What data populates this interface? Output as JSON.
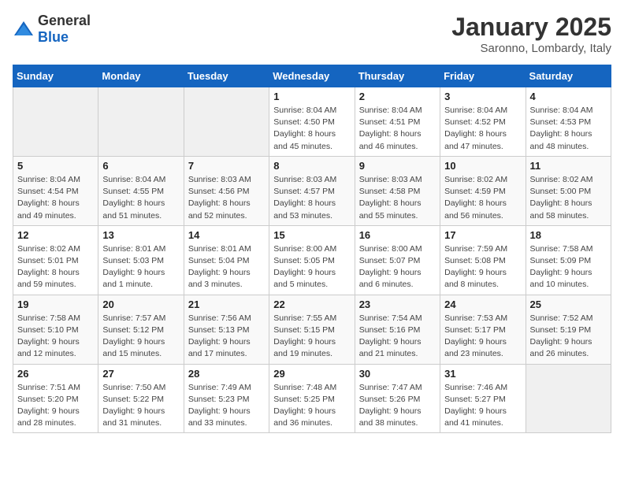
{
  "logo": {
    "general": "General",
    "blue": "Blue"
  },
  "header": {
    "month": "January 2025",
    "location": "Saronno, Lombardy, Italy"
  },
  "weekdays": [
    "Sunday",
    "Monday",
    "Tuesday",
    "Wednesday",
    "Thursday",
    "Friday",
    "Saturday"
  ],
  "weeks": [
    [
      {
        "day": "",
        "info": ""
      },
      {
        "day": "",
        "info": ""
      },
      {
        "day": "",
        "info": ""
      },
      {
        "day": "1",
        "info": "Sunrise: 8:04 AM\nSunset: 4:50 PM\nDaylight: 8 hours and 45 minutes."
      },
      {
        "day": "2",
        "info": "Sunrise: 8:04 AM\nSunset: 4:51 PM\nDaylight: 8 hours and 46 minutes."
      },
      {
        "day": "3",
        "info": "Sunrise: 8:04 AM\nSunset: 4:52 PM\nDaylight: 8 hours and 47 minutes."
      },
      {
        "day": "4",
        "info": "Sunrise: 8:04 AM\nSunset: 4:53 PM\nDaylight: 8 hours and 48 minutes."
      }
    ],
    [
      {
        "day": "5",
        "info": "Sunrise: 8:04 AM\nSunset: 4:54 PM\nDaylight: 8 hours and 49 minutes."
      },
      {
        "day": "6",
        "info": "Sunrise: 8:04 AM\nSunset: 4:55 PM\nDaylight: 8 hours and 51 minutes."
      },
      {
        "day": "7",
        "info": "Sunrise: 8:03 AM\nSunset: 4:56 PM\nDaylight: 8 hours and 52 minutes."
      },
      {
        "day": "8",
        "info": "Sunrise: 8:03 AM\nSunset: 4:57 PM\nDaylight: 8 hours and 53 minutes."
      },
      {
        "day": "9",
        "info": "Sunrise: 8:03 AM\nSunset: 4:58 PM\nDaylight: 8 hours and 55 minutes."
      },
      {
        "day": "10",
        "info": "Sunrise: 8:02 AM\nSunset: 4:59 PM\nDaylight: 8 hours and 56 minutes."
      },
      {
        "day": "11",
        "info": "Sunrise: 8:02 AM\nSunset: 5:00 PM\nDaylight: 8 hours and 58 minutes."
      }
    ],
    [
      {
        "day": "12",
        "info": "Sunrise: 8:02 AM\nSunset: 5:01 PM\nDaylight: 8 hours and 59 minutes."
      },
      {
        "day": "13",
        "info": "Sunrise: 8:01 AM\nSunset: 5:03 PM\nDaylight: 9 hours and 1 minute."
      },
      {
        "day": "14",
        "info": "Sunrise: 8:01 AM\nSunset: 5:04 PM\nDaylight: 9 hours and 3 minutes."
      },
      {
        "day": "15",
        "info": "Sunrise: 8:00 AM\nSunset: 5:05 PM\nDaylight: 9 hours and 5 minutes."
      },
      {
        "day": "16",
        "info": "Sunrise: 8:00 AM\nSunset: 5:07 PM\nDaylight: 9 hours and 6 minutes."
      },
      {
        "day": "17",
        "info": "Sunrise: 7:59 AM\nSunset: 5:08 PM\nDaylight: 9 hours and 8 minutes."
      },
      {
        "day": "18",
        "info": "Sunrise: 7:58 AM\nSunset: 5:09 PM\nDaylight: 9 hours and 10 minutes."
      }
    ],
    [
      {
        "day": "19",
        "info": "Sunrise: 7:58 AM\nSunset: 5:10 PM\nDaylight: 9 hours and 12 minutes."
      },
      {
        "day": "20",
        "info": "Sunrise: 7:57 AM\nSunset: 5:12 PM\nDaylight: 9 hours and 15 minutes."
      },
      {
        "day": "21",
        "info": "Sunrise: 7:56 AM\nSunset: 5:13 PM\nDaylight: 9 hours and 17 minutes."
      },
      {
        "day": "22",
        "info": "Sunrise: 7:55 AM\nSunset: 5:15 PM\nDaylight: 9 hours and 19 minutes."
      },
      {
        "day": "23",
        "info": "Sunrise: 7:54 AM\nSunset: 5:16 PM\nDaylight: 9 hours and 21 minutes."
      },
      {
        "day": "24",
        "info": "Sunrise: 7:53 AM\nSunset: 5:17 PM\nDaylight: 9 hours and 23 minutes."
      },
      {
        "day": "25",
        "info": "Sunrise: 7:52 AM\nSunset: 5:19 PM\nDaylight: 9 hours and 26 minutes."
      }
    ],
    [
      {
        "day": "26",
        "info": "Sunrise: 7:51 AM\nSunset: 5:20 PM\nDaylight: 9 hours and 28 minutes."
      },
      {
        "day": "27",
        "info": "Sunrise: 7:50 AM\nSunset: 5:22 PM\nDaylight: 9 hours and 31 minutes."
      },
      {
        "day": "28",
        "info": "Sunrise: 7:49 AM\nSunset: 5:23 PM\nDaylight: 9 hours and 33 minutes."
      },
      {
        "day": "29",
        "info": "Sunrise: 7:48 AM\nSunset: 5:25 PM\nDaylight: 9 hours and 36 minutes."
      },
      {
        "day": "30",
        "info": "Sunrise: 7:47 AM\nSunset: 5:26 PM\nDaylight: 9 hours and 38 minutes."
      },
      {
        "day": "31",
        "info": "Sunrise: 7:46 AM\nSunset: 5:27 PM\nDaylight: 9 hours and 41 minutes."
      },
      {
        "day": "",
        "info": ""
      }
    ]
  ]
}
